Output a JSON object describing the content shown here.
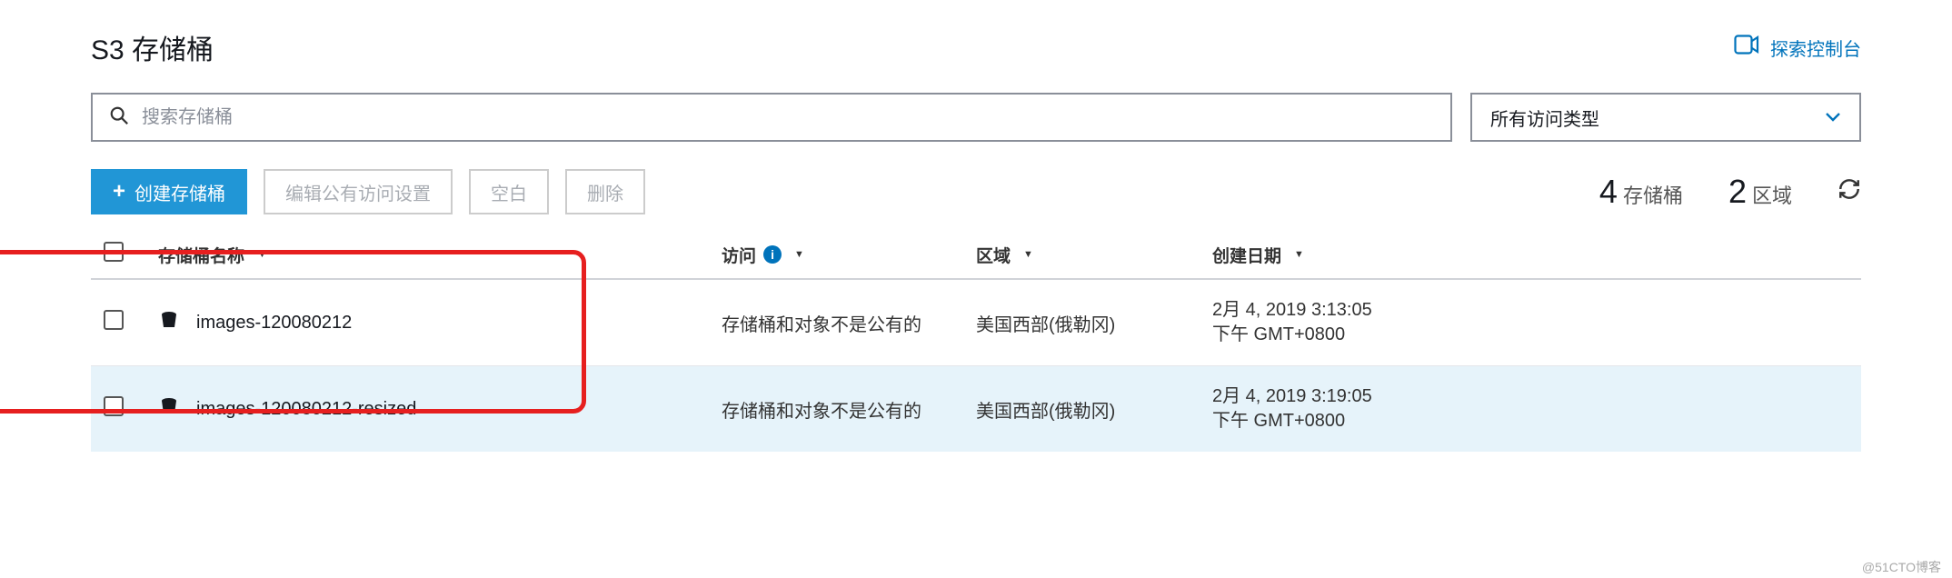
{
  "header": {
    "title": "S3 存储桶",
    "explore_label": "探索控制台"
  },
  "search": {
    "placeholder": "搜索存储桶",
    "filter_label": "所有访问类型"
  },
  "actions": {
    "create_label": "创建存储桶",
    "edit_public_label": "编辑公有访问设置",
    "empty_label": "空白",
    "delete_label": "删除"
  },
  "stats": {
    "bucket_count": "4",
    "bucket_unit": "存储桶",
    "region_count": "2",
    "region_unit": "区域"
  },
  "columns": {
    "name": "存储桶名称",
    "access": "访问",
    "region": "区域",
    "created": "创建日期"
  },
  "rows": [
    {
      "name": "images-120080212",
      "access": "存储桶和对象不是公有的",
      "region": "美国西部(俄勒冈)",
      "created_line1": "2月 4, 2019 3:13:05",
      "created_line2": "下午 GMT+0800"
    },
    {
      "name": "images-120080212-resized",
      "access": "存储桶和对象不是公有的",
      "region": "美国西部(俄勒冈)",
      "created_line1": "2月 4, 2019 3:19:05",
      "created_line2": "下午 GMT+0800"
    }
  ],
  "watermark": "@51CTO博客"
}
